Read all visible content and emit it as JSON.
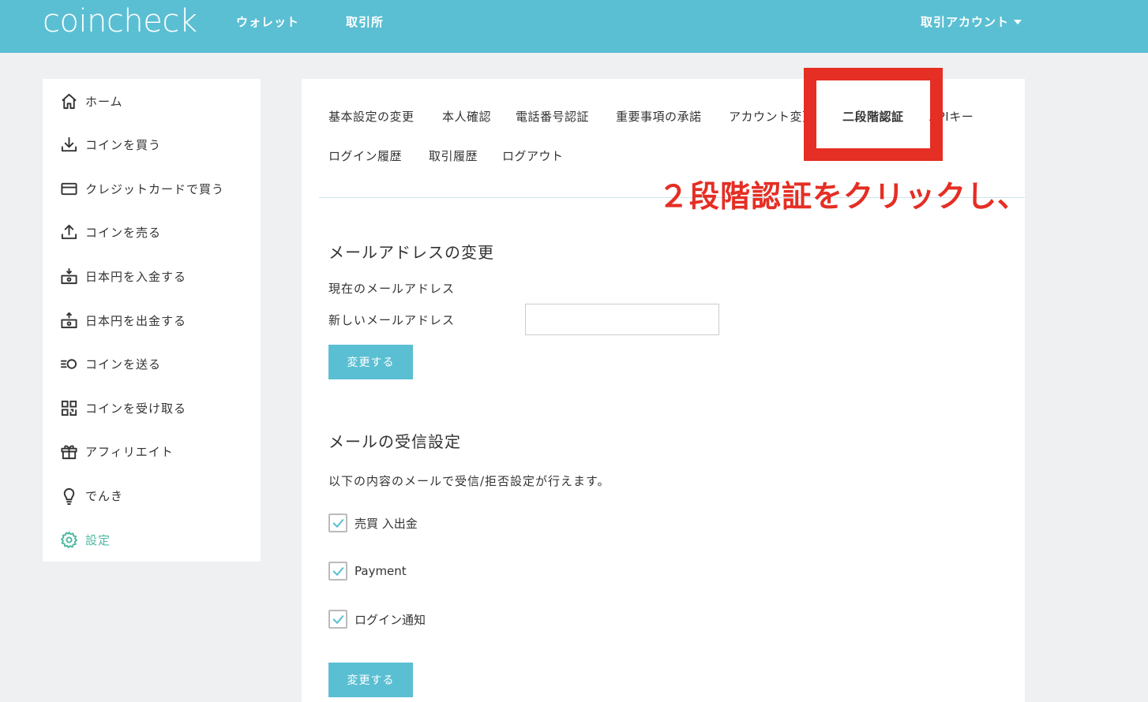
{
  "header": {
    "logo": "coincheck",
    "nav": [
      "ウォレット",
      "取引所"
    ],
    "account": "取引アカウント"
  },
  "sidebar": {
    "items": [
      {
        "label": "ホーム",
        "icon": "home-icon"
      },
      {
        "label": "コインを買う",
        "icon": "download-icon"
      },
      {
        "label": "クレジットカードで買う",
        "icon": "credit-card-icon"
      },
      {
        "label": "コインを売る",
        "icon": "upload-icon"
      },
      {
        "label": "日本円を入金する",
        "icon": "yen-deposit-icon"
      },
      {
        "label": "日本円を出金する",
        "icon": "yen-withdraw-icon"
      },
      {
        "label": "コインを送る",
        "icon": "send-coin-icon"
      },
      {
        "label": "コインを受け取る",
        "icon": "qr-code-icon"
      },
      {
        "label": "アフィリエイト",
        "icon": "gift-icon"
      },
      {
        "label": "でんき",
        "icon": "lightbulb-icon"
      },
      {
        "label": "設定",
        "icon": "gear-icon",
        "active": true
      }
    ]
  },
  "tabs": [
    "基本設定の変更",
    "本人確認",
    "電話番号認証",
    "重要事項の承諾",
    "アカウント変更",
    "二段階認証",
    "APIキー",
    "ログイン履歴",
    "取引履歴",
    "ログアウト"
  ],
  "active_tab": "二段階認証",
  "email_section": {
    "title": "メールアドレスの変更",
    "current_label": "現在のメールアドレス",
    "new_label": "新しいメールアドレス",
    "new_value": "",
    "button": "変更する"
  },
  "mail_settings": {
    "title": "メールの受信設定",
    "description": "以下の内容のメールで受信/拒否設定が行えます。",
    "options": [
      {
        "label": "売買 入出金",
        "checked": true
      },
      {
        "label": "Payment",
        "checked": true
      },
      {
        "label": "ログイン通知",
        "checked": true
      }
    ],
    "button": "変更する"
  },
  "annotation": {
    "text": "２段階認証をクリックし、",
    "color": "#e52e24"
  },
  "colors": {
    "brand": "#5bbfd3",
    "active_menu": "#4fb8a3",
    "annotation_red": "#e52e24"
  }
}
